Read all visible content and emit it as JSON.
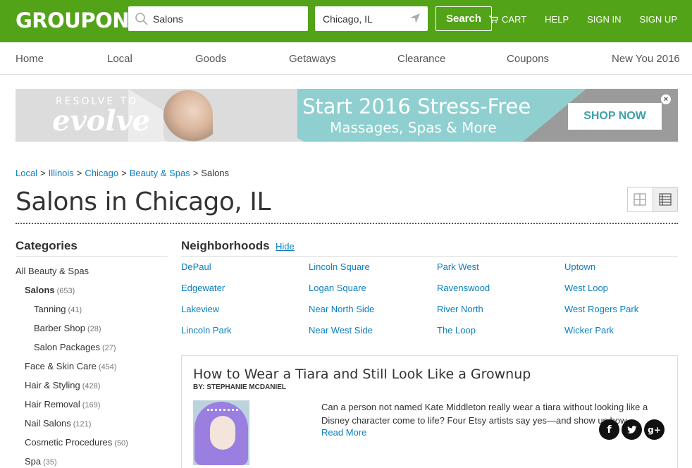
{
  "header": {
    "logo": "GROUPON",
    "search_value": "Salons",
    "location_value": "Chicago, IL",
    "search_button": "Search",
    "links": [
      "CART",
      "HELP",
      "SIGN IN",
      "SIGN UP"
    ],
    "brand_color": "#53a318"
  },
  "nav": {
    "items": [
      "Home",
      "Local",
      "Goods",
      "Getaways",
      "Clearance",
      "Coupons",
      "New You 2016"
    ]
  },
  "banner": {
    "tagline_small": "RESOLVE TO",
    "tagline_big": "evolve",
    "headline": "Start 2016 Stress-Free",
    "subline": "Massages, Spas & More",
    "cta": "SHOP NOW",
    "close": "×"
  },
  "breadcrumb": {
    "links": [
      "Local",
      "Illinois",
      "Chicago",
      "Beauty & Spas"
    ],
    "current": "Salons",
    "sep": ">"
  },
  "page_title": "Salons in Chicago, IL",
  "categories": {
    "heading": "Categories",
    "items": [
      {
        "label": "All Beauty & Spas",
        "count": ""
      },
      {
        "label": "Salons",
        "count": "(653)"
      },
      {
        "label": "Tanning",
        "count": "(41)"
      },
      {
        "label": "Barber Shop",
        "count": "(28)"
      },
      {
        "label": "Salon Packages",
        "count": "(27)"
      },
      {
        "label": "Face & Skin Care",
        "count": "(454)"
      },
      {
        "label": "Hair & Styling",
        "count": "(428)"
      },
      {
        "label": "Hair Removal",
        "count": "(169)"
      },
      {
        "label": "Nail Salons",
        "count": "(121)"
      },
      {
        "label": "Cosmetic Procedures",
        "count": "(50)"
      },
      {
        "label": "Spa",
        "count": "(35)"
      }
    ]
  },
  "neighborhoods": {
    "heading": "Neighborhoods",
    "hide": "Hide",
    "items": [
      "DePaul",
      "Lincoln Square",
      "Park West",
      "Uptown",
      "Edgewater",
      "Logan Square",
      "Ravenswood",
      "West Loop",
      "Lakeview",
      "Near North Side",
      "River North",
      "West Rogers Park",
      "Lincoln Park",
      "Near West Side",
      "The Loop",
      "Wicker Park"
    ]
  },
  "article": {
    "title": "How to Wear a Tiara and Still Look Like a Grownup",
    "byline": "BY: STEPHANIE MCDANIEL",
    "excerpt": "Can a person not named Kate Middleton really wear a tiara without looking like a Disney character come to life? Four Etsy artists say yes—and show us how.",
    "read_more": "Read More",
    "social": [
      "f",
      "t",
      "g+"
    ]
  },
  "link_color": "#0a7fbf"
}
